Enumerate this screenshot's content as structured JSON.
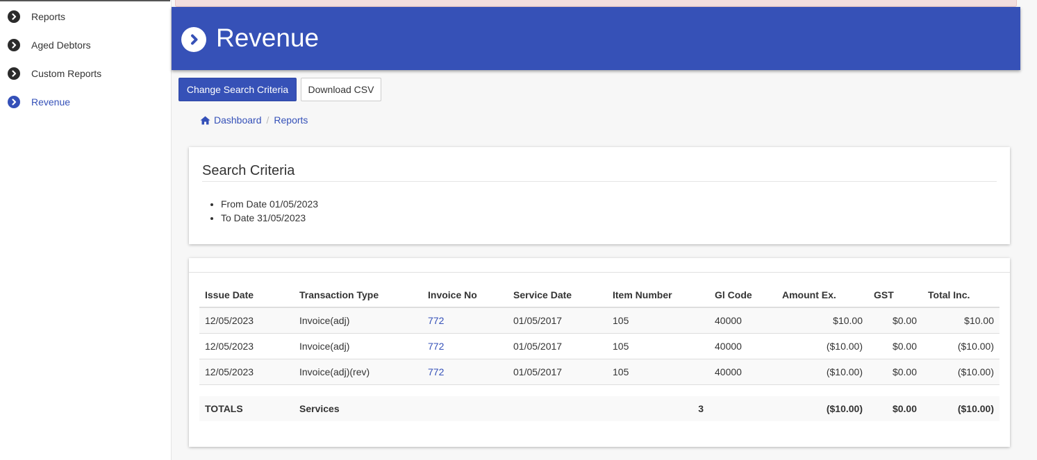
{
  "sidebar": {
    "items": [
      {
        "label": "Reports"
      },
      {
        "label": "Aged Debtors"
      },
      {
        "label": "Custom Reports"
      },
      {
        "label": "Revenue"
      }
    ]
  },
  "header": {
    "title": "Revenue"
  },
  "toolbar": {
    "change_label": "Change Search Criteria",
    "download_label": "Download CSV"
  },
  "breadcrumb": {
    "items": [
      {
        "label": "Dashboard"
      },
      {
        "label": "Reports"
      }
    ],
    "separator": "/"
  },
  "search_criteria": {
    "title": "Search Criteria",
    "items": [
      "From Date 01/05/2023",
      "To Date 31/05/2023"
    ]
  },
  "table": {
    "headers": {
      "issue_date": "Issue Date",
      "transaction_type": "Transaction Type",
      "invoice_no": "Invoice No",
      "service_date": "Service Date",
      "item_number": "Item Number",
      "gl_code": "Gl Code",
      "amount_ex": "Amount Ex.",
      "gst": "GST",
      "total_inc": "Total Inc."
    },
    "rows": [
      {
        "issue_date": "12/05/2023",
        "transaction_type": "Invoice(adj)",
        "invoice_no": "772",
        "service_date": "01/05/2017",
        "item_number": "105",
        "gl_code": "40000",
        "amount_ex": "$10.00",
        "gst": "$0.00",
        "total_inc": "$10.00"
      },
      {
        "issue_date": "12/05/2023",
        "transaction_type": "Invoice(adj)",
        "invoice_no": "772",
        "service_date": "01/05/2017",
        "item_number": "105",
        "gl_code": "40000",
        "amount_ex": "($10.00)",
        "gst": "$0.00",
        "total_inc": "($10.00)"
      },
      {
        "issue_date": "12/05/2023",
        "transaction_type": "Invoice(adj)(rev)",
        "invoice_no": "772",
        "service_date": "01/05/2017",
        "item_number": "105",
        "gl_code": "40000",
        "amount_ex": "($10.00)",
        "gst": "$0.00",
        "total_inc": "($10.00)"
      }
    ],
    "totals": {
      "label": "TOTALS",
      "type": "Services",
      "count": "3",
      "amount_ex": "($10.00)",
      "gst": "$0.00",
      "total_inc": "($10.00)"
    }
  },
  "colors": {
    "brand": "#3651b7",
    "link": "#3450b8",
    "alert": "#f2dede"
  },
  "icons": {
    "nav": "chevron-circle-right-icon",
    "breadcrumb_home": "home-icon"
  }
}
